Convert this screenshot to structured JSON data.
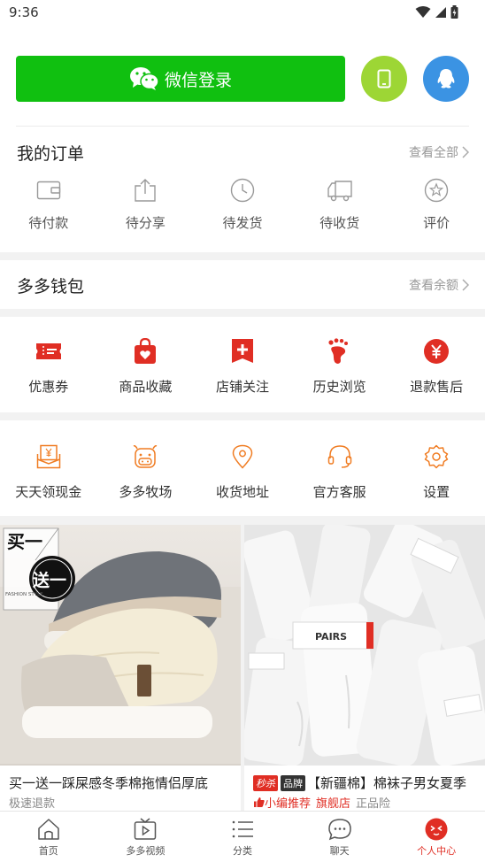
{
  "status_bar": {
    "time": "9:36"
  },
  "login": {
    "wechat_label": "微信登录"
  },
  "orders": {
    "title": "我的订单",
    "link": "查看全部",
    "items": [
      {
        "label": "待付款",
        "icon": "wallet-icon"
      },
      {
        "label": "待分享",
        "icon": "share-icon"
      },
      {
        "label": "待发货",
        "icon": "clock-icon"
      },
      {
        "label": "待收货",
        "icon": "truck-icon"
      },
      {
        "label": "评价",
        "icon": "review-icon"
      }
    ]
  },
  "wallet": {
    "title": "多多钱包",
    "link": "查看余额"
  },
  "grid1": [
    {
      "label": "优惠券",
      "icon": "coupon-icon"
    },
    {
      "label": "商品收藏",
      "icon": "favorite-bag-icon"
    },
    {
      "label": "店铺关注",
      "icon": "store-follow-icon"
    },
    {
      "label": "历史浏览",
      "icon": "footprint-icon"
    },
    {
      "label": "退款售后",
      "icon": "refund-icon"
    }
  ],
  "grid2": [
    {
      "label": "天天领现金",
      "icon": "cash-envelope-icon"
    },
    {
      "label": "多多牧场",
      "icon": "cow-icon"
    },
    {
      "label": "收货地址",
      "icon": "location-icon"
    },
    {
      "label": "官方客服",
      "icon": "headset-icon"
    },
    {
      "label": "设置",
      "icon": "settings-icon"
    }
  ],
  "products": [
    {
      "title": "买一送一踩屎感冬季棉拖情侣厚底",
      "sub": "极速退款",
      "image_text_1": "买一",
      "image_text_2": "送一",
      "image_text_3": "FASHION STYLE"
    },
    {
      "badge_1": "秒杀",
      "badge_2": "品牌",
      "title": "【新疆棉】棉袜子男女夏季",
      "sub_1": "小编推荐",
      "sub_2": "旗舰店",
      "sub_3": "正品险",
      "image_text": "PAIRS"
    }
  ],
  "bottom_nav": [
    {
      "label": "首页",
      "icon": "home-icon",
      "active": false
    },
    {
      "label": "多多视频",
      "icon": "video-icon",
      "active": false
    },
    {
      "label": "分类",
      "icon": "category-icon",
      "active": false
    },
    {
      "label": "聊天",
      "icon": "chat-icon",
      "active": false
    },
    {
      "label": "个人中心",
      "icon": "profile-icon",
      "active": true
    }
  ],
  "colors": {
    "wechat_green": "#10c010",
    "phone_green": "#9dd635",
    "qq_blue": "#3b93e3",
    "red": "#e02e24",
    "orange": "#f07c22"
  }
}
